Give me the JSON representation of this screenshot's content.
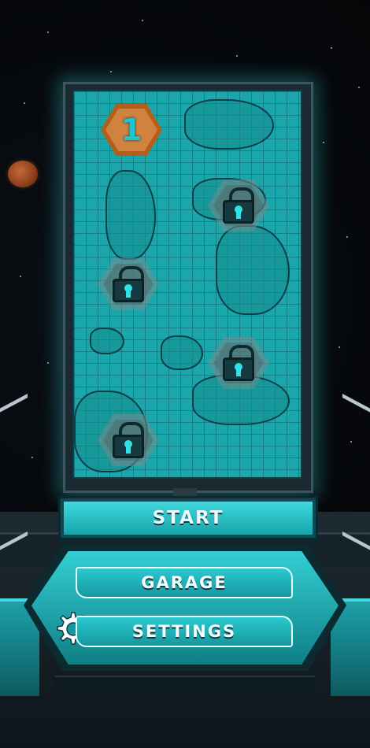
{
  "level_map": {
    "unlocked_level": {
      "number": "1"
    },
    "locked_levels": [
      {
        "icon": "lock-icon"
      },
      {
        "icon": "lock-icon"
      },
      {
        "icon": "lock-icon"
      },
      {
        "icon": "lock-icon"
      }
    ]
  },
  "buttons": {
    "start": "START",
    "garage": "GARAGE",
    "settings": "SETTINGS"
  },
  "colors": {
    "accent": "#33cfd4",
    "unlocked_level": "#b55e1c",
    "background": "#05070a"
  }
}
